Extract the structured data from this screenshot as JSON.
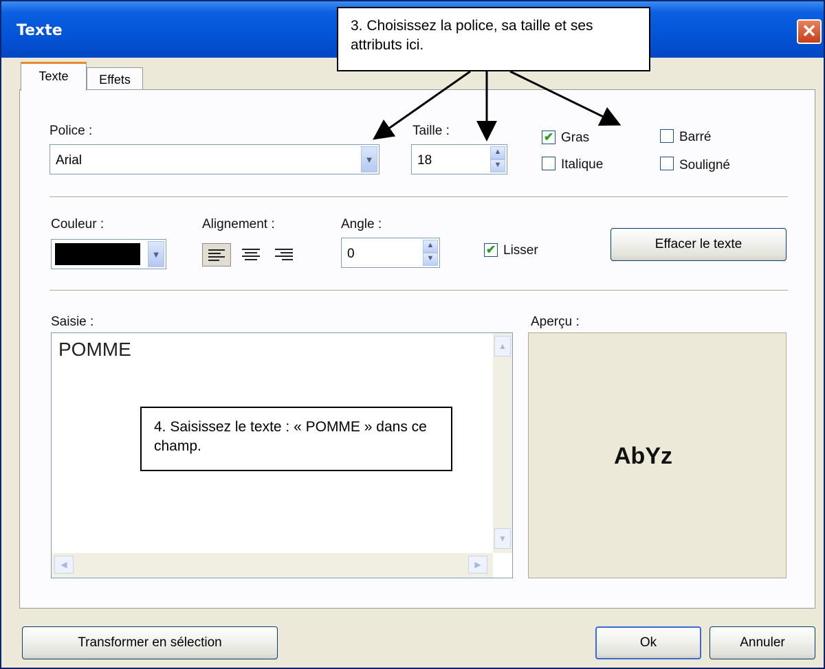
{
  "window": {
    "title": "Texte",
    "close_glyph": "✕"
  },
  "tabs": [
    {
      "label": "Texte",
      "active": true
    },
    {
      "label": "Effets",
      "active": false
    }
  ],
  "font": {
    "label": "Police :",
    "value": "Arial"
  },
  "size": {
    "label": "Taille :",
    "value": "18"
  },
  "styles": {
    "bold": {
      "label": "Gras",
      "checked": true
    },
    "italic": {
      "label": "Italique",
      "checked": false
    },
    "strike": {
      "label": "Barré",
      "checked": false
    },
    "underline": {
      "label": "Souligné",
      "checked": false
    }
  },
  "color": {
    "label": "Couleur :",
    "value": "#000000"
  },
  "alignment": {
    "label": "Alignement :",
    "options": [
      "left",
      "center",
      "right"
    ],
    "selected": "left"
  },
  "angle": {
    "label": "Angle :",
    "value": "0"
  },
  "smooth": {
    "label": "Lisser",
    "checked": true
  },
  "clear_button": "Effacer le texte",
  "input": {
    "label": "Saisie :",
    "value": "POMME"
  },
  "preview": {
    "label": "Aperçu :",
    "sample": "AbYz"
  },
  "callouts": {
    "step3": "3. Choisissez la police, sa taille et ses attributs ici.",
    "step4": "4. Saisissez le texte : « POMME » dans ce champ."
  },
  "footer": {
    "transform_button": "Transformer en sélection",
    "ok_button": "Ok",
    "cancel_button": "Annuler"
  },
  "colors": {
    "titlebar": "#0454d8",
    "dialog_bg": "#ece9d8",
    "check": "#21a121"
  }
}
